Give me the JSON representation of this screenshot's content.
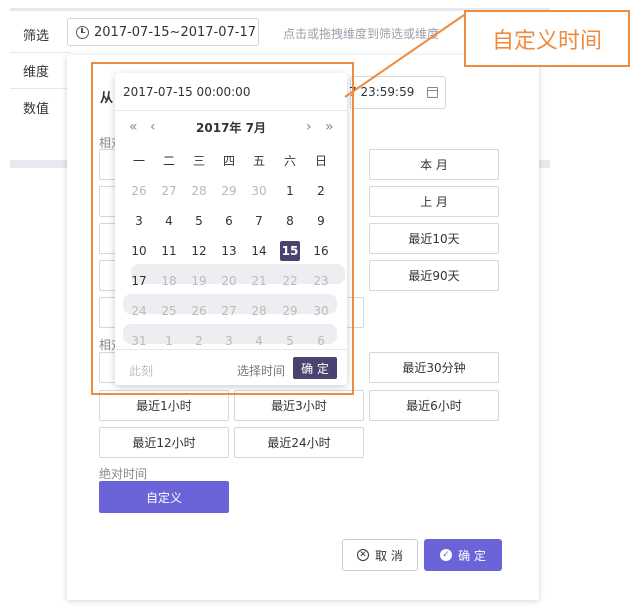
{
  "filter": {
    "label": "筛选",
    "dimension_label": "维度",
    "value_label": "数值",
    "date_range": "2017-07-15~2017-07-17",
    "drag_hint": "点击或拖拽维度到筛选或维度"
  },
  "range_input": {
    "from_label": "从",
    "from_value": "2017-07-15 00:00:00",
    "to_value_partial": "7 23:59:59"
  },
  "calendar": {
    "title": "2017年 7月",
    "prev_year": "«",
    "prev_month": "‹",
    "next_month": "›",
    "next_year": "»",
    "weekdays": [
      "一",
      "二",
      "三",
      "四",
      "五",
      "六",
      "日"
    ],
    "weeks": [
      [
        "26",
        "27",
        "28",
        "29",
        "30",
        "1",
        "2"
      ],
      [
        "3",
        "4",
        "5",
        "6",
        "7",
        "8",
        "9"
      ],
      [
        "10",
        "11",
        "12",
        "13",
        "14",
        "15",
        "16"
      ],
      [
        "17",
        "18",
        "19",
        "20",
        "21",
        "22",
        "23"
      ],
      [
        "24",
        "25",
        "26",
        "27",
        "28",
        "29",
        "30"
      ],
      [
        "31",
        "1",
        "2",
        "3",
        "4",
        "5",
        "6"
      ]
    ],
    "selected_day": "15",
    "footer": {
      "now": "此刻",
      "select_time": "选择时间",
      "confirm": "确 定"
    }
  },
  "sections": {
    "relative_date_partial": "相对",
    "relative_time_partial": "相对",
    "absolute_time": "绝对时间"
  },
  "quick_buttons": {
    "this_month": "本 月",
    "last_month": "上 月",
    "last_10_days": "最近10天",
    "last_90_days": "最近90天",
    "last_30_min": "最近30分钟",
    "last_1h": "最近1小时",
    "last_3h": "最近3小时",
    "last_6h": "最近6小时",
    "last_12h": "最近12小时",
    "last_24h": "最近24小时",
    "custom": "自定义"
  },
  "actions": {
    "cancel": "取 消",
    "ok": "确 定"
  },
  "annotation": {
    "label": "自定义时间",
    "color": "#f08a3c"
  },
  "colors": {
    "accent": "#6a64d8",
    "selected_day": "#4b4270"
  }
}
